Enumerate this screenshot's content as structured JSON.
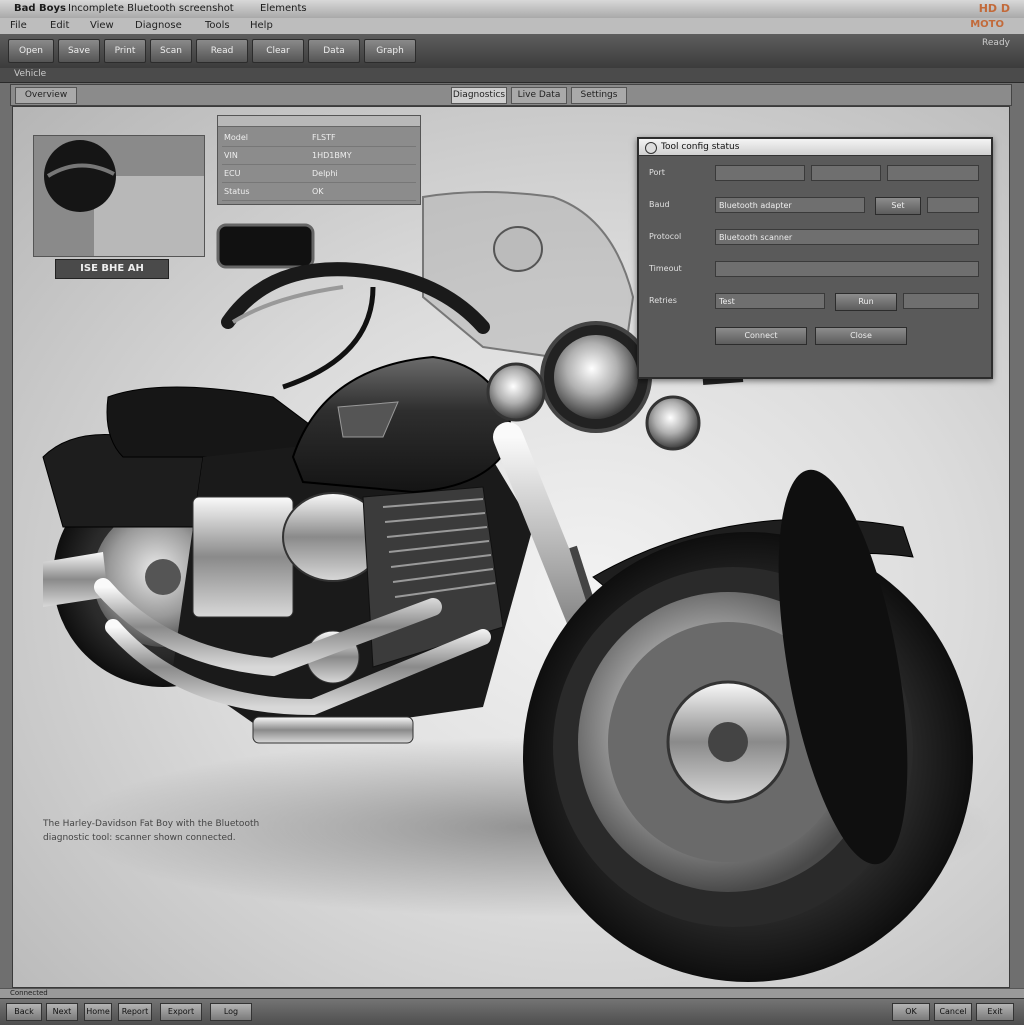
{
  "window": {
    "title": "Bad Boys",
    "title_detail": "Incomplete Bluetooth screenshot",
    "title_center": "Elements",
    "brand": "HD D"
  },
  "menu": {
    "items": [
      "File",
      "Edit",
      "View",
      "Diagnose",
      "Tools",
      "Help"
    ],
    "right": "MOTO"
  },
  "toolbar": {
    "buttons": [
      "Open",
      "Save",
      "Print",
      "Scan",
      "Read",
      "Clear",
      "Data",
      "Graph"
    ],
    "right_text": "Ready"
  },
  "subbar": {
    "text": "Vehicle"
  },
  "tabs": [
    "Overview",
    "Diagnostics",
    "Live Data",
    "Settings"
  ],
  "thumbnail": {
    "label": "ISE BHE AH"
  },
  "info_panel": {
    "rows": [
      {
        "a": "Model",
        "b": "FLSTF"
      },
      {
        "a": "VIN",
        "b": "1HD1BMY"
      },
      {
        "a": "ECU",
        "b": "Delphi"
      },
      {
        "a": "Status",
        "b": "OK"
      }
    ]
  },
  "dialog": {
    "title": "Tool config status",
    "rows": [
      {
        "label": "Port",
        "field": "",
        "btn": ""
      },
      {
        "label": "Baud",
        "field": "Bluetooth adapter",
        "btn": "Set"
      },
      {
        "label": "Protocol",
        "field": "Bluetooth scanner",
        "btn": ""
      },
      {
        "label": "Timeout",
        "field": "",
        "btn": ""
      },
      {
        "label": "Retries",
        "field": "Test",
        "btn": "Run"
      },
      {
        "label": "",
        "field": "Connect",
        "btn": "Close"
      }
    ]
  },
  "caption": {
    "line1": "The Harley-Davidson Fat Boy with the Bluetooth",
    "line2": "diagnostic tool: scanner shown connected."
  },
  "statusbar": {
    "text": "Connected"
  },
  "bottom_buttons": [
    "Back",
    "Next",
    "Home",
    "Report",
    "Export",
    "Log",
    "OK",
    "Cancel",
    "Exit"
  ]
}
